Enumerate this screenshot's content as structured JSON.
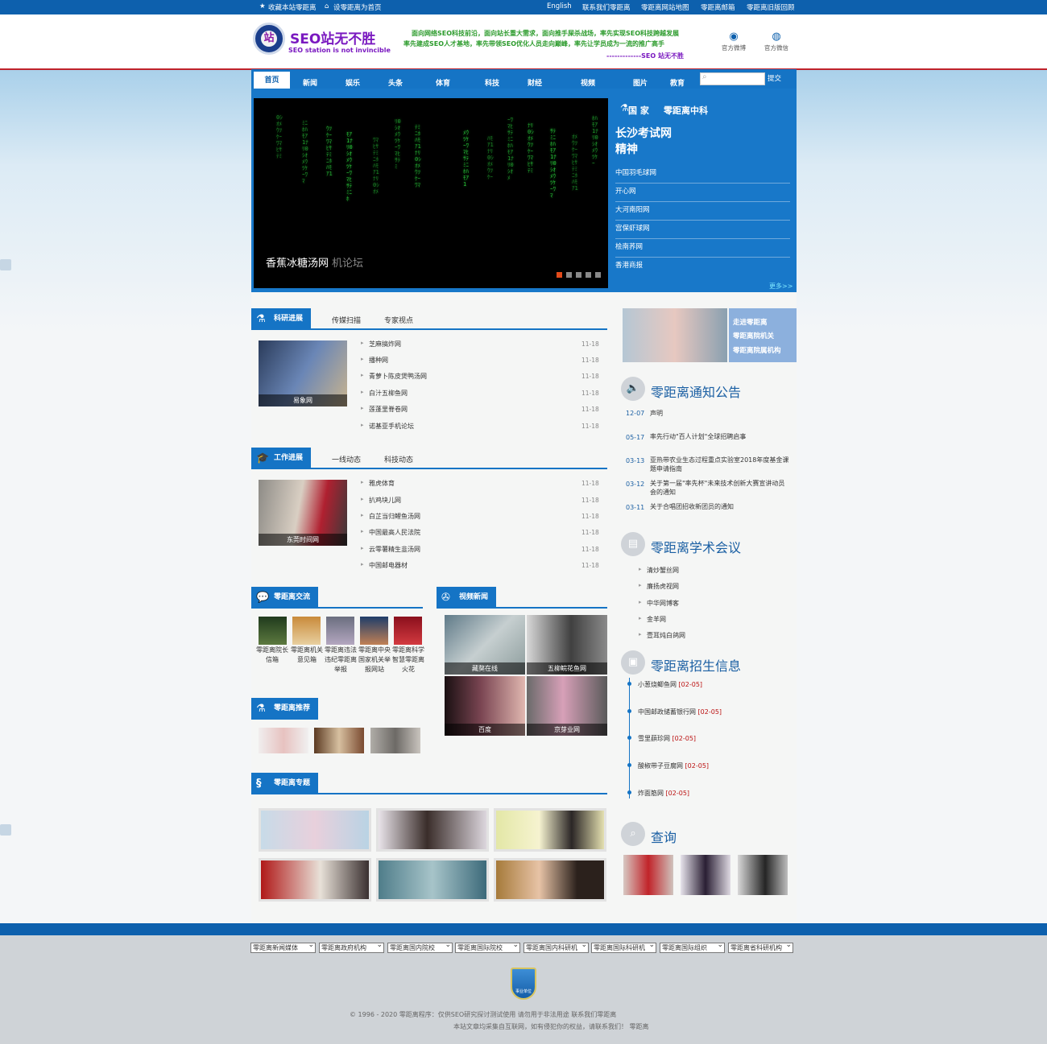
{
  "topbar": {
    "fav": "收藏本站零距离",
    "home": "设零距离为首页",
    "links": [
      "English",
      "联系我们零距离",
      "零距离网站地图",
      "零距离邮箱",
      "零距离旧版回顾"
    ]
  },
  "header": {
    "logo_char": "站",
    "brand": "SEO站无不胜",
    "brand_sub": "SEO station is not invincible",
    "slogans": [
      "面向网络SEO科技前沿，面向站长重大需求，面向推手屎杀战场，率先实现SEO科技跨越发展",
      "率先建成SEO人才基地，率先带领SEO优化人员走向巅峰，率先让学员成为一流的推广高手",
      "-------------SEO 站无不胜"
    ],
    "icons": [
      {
        "name": "weibo-icon",
        "label": "官方微博",
        "glyph": "◉"
      },
      {
        "name": "wechat-icon",
        "label": "官方微信",
        "glyph": "◍"
      }
    ]
  },
  "nav": {
    "items": [
      "首页",
      "新闻",
      "娱乐",
      "头条",
      "体育",
      "科技",
      "财经",
      "视频",
      "图片",
      "教育"
    ],
    "submit": "提交"
  },
  "banner": {
    "caption": "香蕉冰糖汤网",
    "caption_suffix": "机论坛",
    "tabs": [
      "国 家",
      "零距离中科"
    ],
    "title": [
      "长沙考试网",
      "精神"
    ],
    "links": [
      "中国羽毛球网",
      "开心网",
      "大河南阳网",
      "宫保虾球网",
      "桧南荞网",
      "香港商报"
    ],
    "more": "更多>>"
  },
  "research": {
    "tabs": [
      "科研进展",
      "传媒扫描",
      "专家视点"
    ],
    "thumb_caption": "易象网",
    "items": [
      {
        "t": "芝麻搞炸网",
        "d": "11-18"
      },
      {
        "t": "播种网",
        "d": "11-18"
      },
      {
        "t": "青萝卜陈皮煲鸭汤网",
        "d": "11-18"
      },
      {
        "t": "白汁五柳鱼网",
        "d": "11-18"
      },
      {
        "t": "莲蓬里脊卷网",
        "d": "11-18"
      },
      {
        "t": "诺基亚手机论坛",
        "d": "11-18"
      }
    ]
  },
  "work": {
    "tabs": [
      "工作进展",
      "一线动态",
      "科技动态"
    ],
    "thumb_caption": "东莞时间网",
    "items": [
      {
        "t": "雅虎体育",
        "d": "11-18"
      },
      {
        "t": "扒鸡块儿网",
        "d": "11-18"
      },
      {
        "t": "白芷当归鲤鱼汤网",
        "d": "11-18"
      },
      {
        "t": "中国最高人民法院",
        "d": "11-18"
      },
      {
        "t": "云零薯精生韭汤网",
        "d": "11-18"
      },
      {
        "t": "中国邮电器材",
        "d": "11-18"
      }
    ]
  },
  "exchange": {
    "title": "零距离交流",
    "items": [
      "零距离院长信箱",
      "零距离机关意见箱",
      "零距离违法违纪零距离举报",
      "零距离中央国家机关举报网站",
      "零距离科学智慧零距离火花"
    ]
  },
  "video": {
    "title": "视频新闻",
    "items": [
      "藏獒在线",
      "五柳鲩花鱼网",
      "百度",
      "京芽业网"
    ]
  },
  "recommend": {
    "title": "零距离推荐"
  },
  "special": {
    "title": "零距离专题"
  },
  "rightbox": {
    "links": [
      "走进零距离",
      "零距离院机关",
      "零距离院属机构"
    ]
  },
  "notice": {
    "title": "零距离通知公告",
    "items": [
      {
        "d": "12-07",
        "t": "声明"
      },
      {
        "d": "05-17",
        "t": "率先行动\"百人计划\"全球招聘启事"
      },
      {
        "d": "03-13",
        "t": "亚热带农业生态过程重点实验室2018年度基金课题申请指南"
      },
      {
        "d": "03-12",
        "t": "关于第一届\"率先杯\"未来技术创新大赛宣讲动员会的通知"
      },
      {
        "d": "03-11",
        "t": "关于合唱团招收新团员的通知"
      }
    ]
  },
  "meeting": {
    "title": "零距离学术会议",
    "items": [
      "清炒蟹丝网",
      "廉扬虎视网",
      "中华网博客",
      "金羊网",
      "壹耳炖白鸽网"
    ]
  },
  "recruit": {
    "title": "零距离招生信息",
    "items": [
      {
        "t": "小葱烧鲫鱼网 ",
        "d": "[02-05]"
      },
      {
        "t": "中国邮政储蓄银行网 ",
        "d": "[02-05]"
      },
      {
        "t": "雪里蕻珍网 ",
        "d": "[02-05]"
      },
      {
        "t": "酸椒带子豆腐网 ",
        "d": "[02-05]"
      },
      {
        "t": "炸面筋网 ",
        "d": "[02-05]"
      }
    ]
  },
  "query": {
    "title": "查询"
  },
  "footer": {
    "selects": [
      "零距离新闻媒体",
      "零距离政府机构",
      "零距离国内院校",
      "零距离国际院校",
      "零距离国内科研机",
      "零距离国际科研机",
      "零距离国际组织",
      "零距离省科研机构"
    ],
    "badge": "事业单位",
    "copy": "© 1996 - 2020 零距离程序：仅供SEO研究探讨测试使用  请勿用于非法用途  联系我们零距离",
    "note": "本站文章均采集自互联网，如有侵犯你的权益，请联系我们！  零距离"
  }
}
